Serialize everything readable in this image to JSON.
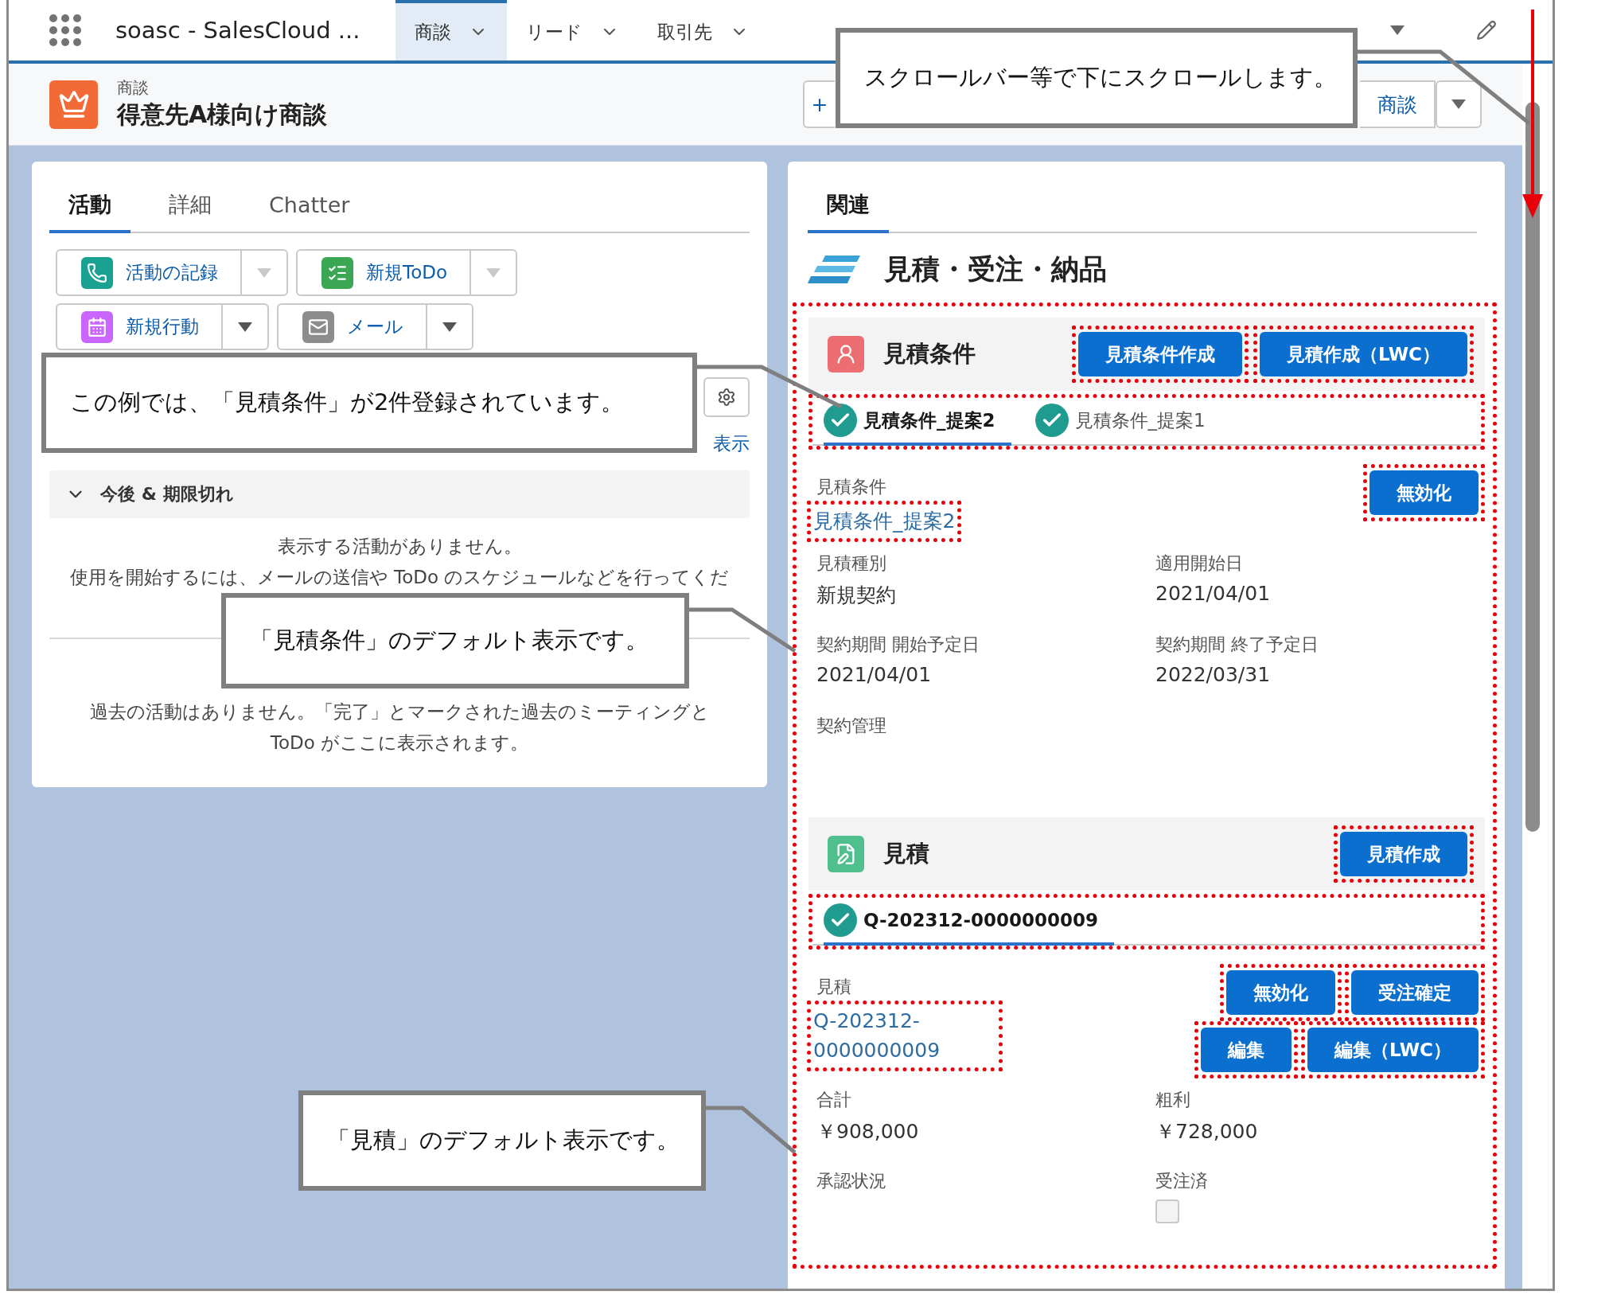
{
  "nav": {
    "app_name": "soasc - SalesCloud ...",
    "tabs": [
      {
        "label": "商談",
        "selected": true
      },
      {
        "label": "リード",
        "selected": false
      },
      {
        "label": "取引先",
        "selected": false
      }
    ]
  },
  "record_header": {
    "object_type": "商談",
    "title": "得意先A様向け商談",
    "new_button": "+",
    "split_button": "商談"
  },
  "left_panel": {
    "tabs": [
      {
        "label": "活動",
        "selected": true
      },
      {
        "label": "詳細",
        "selected": false
      },
      {
        "label": "Chatter",
        "selected": false
      }
    ],
    "actions": [
      {
        "label": "活動の記録",
        "kind": "call",
        "disabled": true
      },
      {
        "label": "新規ToDo",
        "kind": "task",
        "disabled": true
      },
      {
        "label": "新規行動",
        "kind": "event",
        "disabled": false
      },
      {
        "label": "メール",
        "kind": "email",
        "disabled": false
      }
    ],
    "filter_link": "表示",
    "upcoming": {
      "title": "今後 & 期限切れ",
      "expanded": true,
      "lines": [
        "表示する活動がありません。",
        "使用を開始するには、メールの送信や ToDo のスケジュールなどを行ってくだ"
      ]
    },
    "past_lines": [
      "過去の活動はありません。「完了」とマークされた過去のミーティングと",
      "ToDo がここに表示されます。"
    ]
  },
  "right_panel": {
    "tabs": [
      {
        "label": "関連",
        "selected": true
      }
    ],
    "section_title": "見積・受注・納品",
    "highlighted": true,
    "subsections": [
      {
        "kind": "conditions",
        "title": "見積条件",
        "header_buttons": [
          "見積条件作成",
          "見積作成（LWC）"
        ],
        "records": [
          {
            "label": "見積条件_提案2",
            "selected": true
          },
          {
            "label": "見積条件_提案1",
            "selected": false
          }
        ],
        "name_label": "見積条件",
        "name_value": "見積条件_提案2",
        "action_rows": [
          [
            "無効化"
          ]
        ],
        "fields": [
          {
            "label": "見積種別",
            "value": "新規契約"
          },
          {
            "label": "適用開始日",
            "value": "2021/04/01"
          },
          {
            "label": "契約期間 開始予定日",
            "value": "2021/04/01"
          },
          {
            "label": "契約期間 終了予定日",
            "value": "2022/03/31"
          },
          {
            "label": "契約管理"
          }
        ]
      },
      {
        "kind": "quote",
        "title": "見積",
        "header_buttons": [
          "見積作成"
        ],
        "records": [
          {
            "label": "Q-202312-0000000009",
            "selected": true
          }
        ],
        "name_label": "見積",
        "name_value": "Q-202312-0000000009",
        "action_rows": [
          [
            "無効化",
            "受注確定"
          ],
          [
            "編集",
            "編集（LWC）"
          ]
        ],
        "fields": [
          {
            "label": "合計",
            "value": "￥908,000"
          },
          {
            "label": "粗利",
            "value": "￥728,000"
          },
          {
            "label": "承認状況"
          },
          {
            "label": "受注済",
            "kind": "checkbox",
            "checked": false
          }
        ]
      }
    ]
  },
  "callouts": [
    {
      "text": "スクロールバー等で下にスクロールします。"
    },
    {
      "text": "この例では、「見積条件」が2件登録されています。"
    },
    {
      "text": "「見積条件」のデフォルト表示です。"
    },
    {
      "text": "「見積」のデフォルト表示です。"
    }
  ]
}
